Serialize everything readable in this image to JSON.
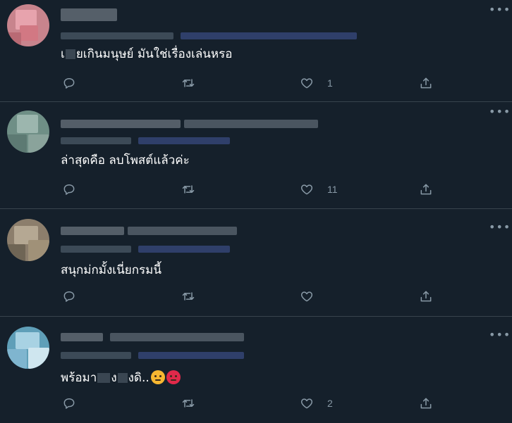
{
  "tweets": [
    {
      "text_before": "เ",
      "text_after": "ยเกินมนุษย์ มันใช่เรื่องเล่นหรอ",
      "reply_count": "",
      "retweet_count": "",
      "like_count": "1",
      "avatar_colors": [
        "#c8848d",
        "#e7a3ad",
        "#d27883",
        "#b96a74"
      ]
    },
    {
      "text": "ล่าสุดคือ ลบโพสต์แล้วค่ะ",
      "reply_count": "",
      "retweet_count": "",
      "like_count": "11",
      "avatar_colors": [
        "#6f8f86",
        "#9cb6ae",
        "#5d7a73",
        "#8aa39b"
      ]
    },
    {
      "text": "สนุกม่กมั้งเนี่ยกรมนี้",
      "reply_count": "",
      "retweet_count": "",
      "like_count": "",
      "avatar_colors": [
        "#8c7e6c",
        "#b5a893",
        "#6f6555",
        "#a09178"
      ]
    },
    {
      "text_before": "พร้อมา",
      "text_middle": "ง",
      "text_after": "งดิ..",
      "reply_count": "",
      "retweet_count": "",
      "like_count": "2",
      "emoji": [
        "angry-face-emoji",
        "pouting-face-emoji"
      ],
      "avatar_colors": [
        "#5f9fb8",
        "#a8d2e3",
        "#7fb5cf",
        "#cfe6ef"
      ]
    }
  ],
  "icons": {
    "more": "more-icon",
    "reply": "reply-icon",
    "retweet": "retweet-icon",
    "like": "heart-icon",
    "share": "share-icon"
  },
  "colors": {
    "background": "#15202b",
    "divider": "#38444d",
    "secondary_text": "#8899a6",
    "text": "#ffffff"
  }
}
